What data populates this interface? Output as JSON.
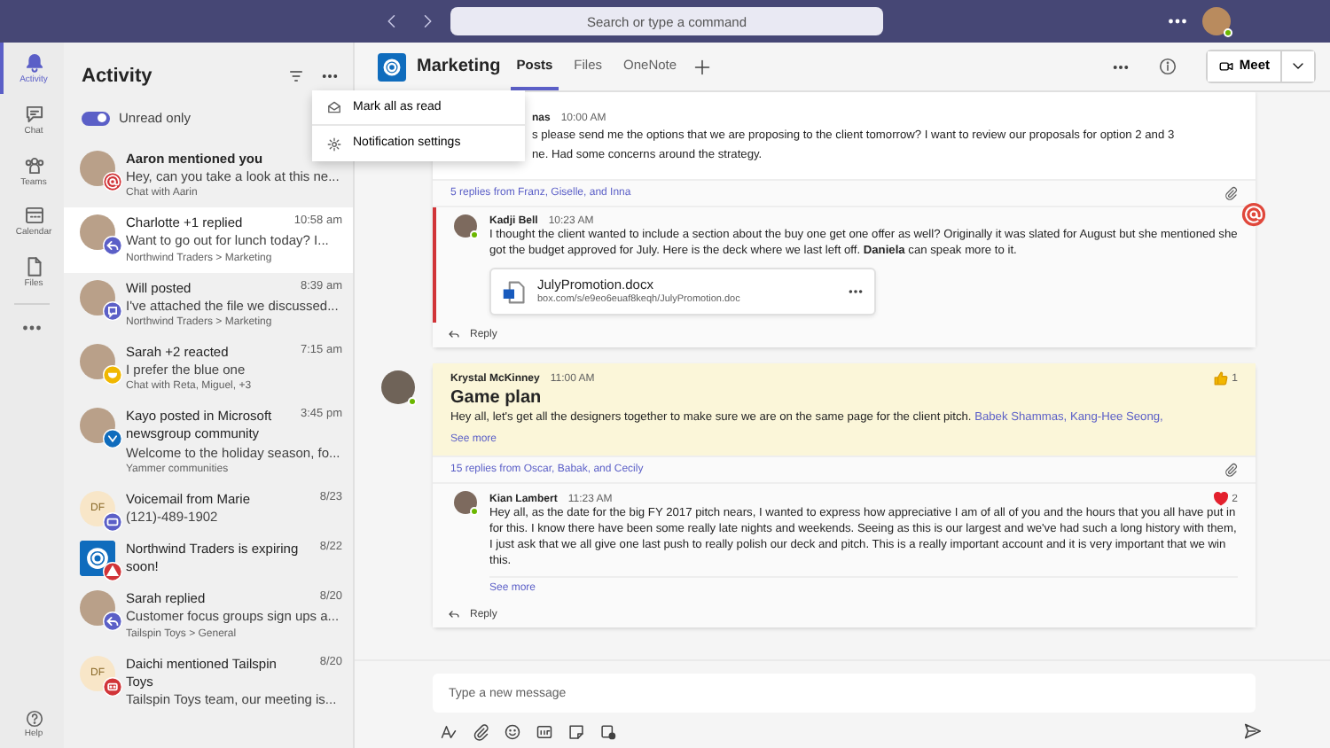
{
  "top_bar": {
    "search": {
      "placeholder": "Search or type a command"
    }
  },
  "rail": {
    "items": [
      {
        "label": "Activity",
        "selected": true
      },
      {
        "label": "Chat",
        "selected": false
      },
      {
        "label": "Teams",
        "selected": false
      },
      {
        "label": "Calendar",
        "selected": false
      },
      {
        "label": "Files",
        "selected": false
      }
    ],
    "help": "Help"
  },
  "activity": {
    "title": "Activity",
    "unread_toggle": {
      "label": "Unread only",
      "on": true
    },
    "items": [
      {
        "title": "Aaron mentioned you",
        "preview": "Hey, can you take a look at this ne...",
        "meta": "Chat with Aarin",
        "avatar": {
          "kind": "photo"
        },
        "badge": {
          "kind": "mention",
          "color": "#d13438"
        },
        "unread": true,
        "selected": false
      },
      {
        "title": "Charlotte +1 replied",
        "time": "10:58 am",
        "preview": "Want to go out for lunch today? I...",
        "meta": "Northwind Traders > Marketing",
        "avatar": {
          "kind": "photo"
        },
        "badge": {
          "kind": "reply",
          "color": "#5b5fc7"
        },
        "unread": false,
        "selected": true
      },
      {
        "title": "Will posted",
        "time": "8:39 am",
        "preview": "I've attached the file we discussed...",
        "meta": "Northwind Traders > Marketing",
        "avatar": {
          "kind": "photo"
        },
        "badge": {
          "kind": "post",
          "color": "#5b5fc7"
        },
        "unread": false,
        "selected": false
      },
      {
        "title": "Sarah +2 reacted",
        "time": "7:15 am",
        "preview": "I prefer the blue one",
        "meta": "Chat with Reta, Miguel, +3",
        "avatar": {
          "kind": "photo"
        },
        "badge": {
          "kind": "reaction",
          "color": "#f0b700"
        },
        "unread": false,
        "selected": false
      },
      {
        "title": "Kayo posted in Microsoft newsgroup community",
        "time": "3:45 pm",
        "preview": "Welcome to the holiday season, fo...",
        "meta": "Yammer communities",
        "avatar": {
          "kind": "photo"
        },
        "badge": {
          "kind": "yammer",
          "color": "#0f6cbd"
        },
        "unread": false,
        "selected": false
      },
      {
        "title": "Voicemail from Marie",
        "time": "8/23",
        "preview": "(121)-489-1902",
        "avatar": {
          "kind": "initials",
          "initials": "DF"
        },
        "badge": {
          "kind": "voicemail",
          "color": "#5b5fc7"
        },
        "unread": false,
        "selected": false
      },
      {
        "title": "Northwind Traders is expiring soon!",
        "time": "8/22",
        "avatar": {
          "kind": "logo"
        },
        "badge": {
          "kind": "alert",
          "color": "#d13438"
        },
        "unread": false,
        "selected": false
      },
      {
        "title": "Sarah replied",
        "time": "8/20",
        "preview": "Customer focus groups sign ups a...",
        "meta": "Tailspin Toys > General",
        "avatar": {
          "kind": "photo"
        },
        "badge": {
          "kind": "reply",
          "color": "#5b5fc7"
        },
        "unread": false,
        "selected": false
      },
      {
        "title": "Daichi mentioned Tailspin Toys",
        "time": "8/20",
        "preview": "Tailspin Toys team, our meeting is...",
        "avatar": {
          "kind": "initials",
          "initials": "DF"
        },
        "badge": {
          "kind": "team_mention",
          "color": "#d13438"
        },
        "unread": false,
        "selected": false
      }
    ]
  },
  "menu": {
    "items": [
      {
        "label": "Mark all as read"
      },
      {
        "label": "Notification settings"
      }
    ]
  },
  "channel": {
    "name": "Marketing",
    "tabs": [
      {
        "label": "Posts",
        "selected": true
      },
      {
        "label": "Files",
        "selected": false
      },
      {
        "label": "OneNote",
        "selected": false
      }
    ],
    "meet": "Meet"
  },
  "threads": [
    {
      "highlighted": false,
      "author": "nas",
      "time": "10:00 AM",
      "lines": [
        "s please send me the options that we are proposing to the client tomorrow? I want to review our proposals for option 2 and 3",
        "ne. Had some concerns around the strategy."
      ],
      "replies_summary": "5 replies from Franz, Giselle, and Inna",
      "reply": {
        "author": "Kadji Bell",
        "time": "10:23 AM",
        "mentioned": true,
        "text": "I thought the client wanted to include a section about the buy one get one offer as well? Originally it was slated for August but she mentioned she got the budget approved for July. Here is the deck where we last left off. **Daniela** can speak more to it.",
        "attachment": {
          "name": "JulyPromotion.docx",
          "url": "box.com/s/e9eo6euaf8keqh/JulyPromotion.doc"
        }
      },
      "reply_label": "Reply"
    },
    {
      "highlighted": true,
      "author": "Krystal McKinney",
      "time": "11:00 AM",
      "subject": "Game plan",
      "lines": [
        "Hey all, let's get all the designers together to make sure we are on the same page for the client pitch."
      ],
      "mentions": [
        "Babek Shammas,",
        "Kang-Hee Seong,"
      ],
      "see_more": "See more",
      "reaction": {
        "kind": "like",
        "count": "1"
      },
      "replies_summary": "15 replies from Oscar, Babak, and Cecily",
      "reply": {
        "author": "Kian Lambert",
        "time": "11:23 AM",
        "mentioned": false,
        "text": "Hey all, as the date for the big FY 2017 pitch nears, I wanted to express how appreciative I am of all of you and the hours that you all have put in for this. I know there have been some really late nights and weekends. Seeing as this is our largest and we've had such a long history with them, I just ask that we all give one last push to really polish our deck and pitch. This is a really important account and it is very important that we win this.",
        "see_more": "See more",
        "reaction": {
          "kind": "heart",
          "count": "2"
        }
      },
      "reply_label": "Reply"
    }
  ],
  "compose": {
    "placeholder": "Type a new message"
  }
}
